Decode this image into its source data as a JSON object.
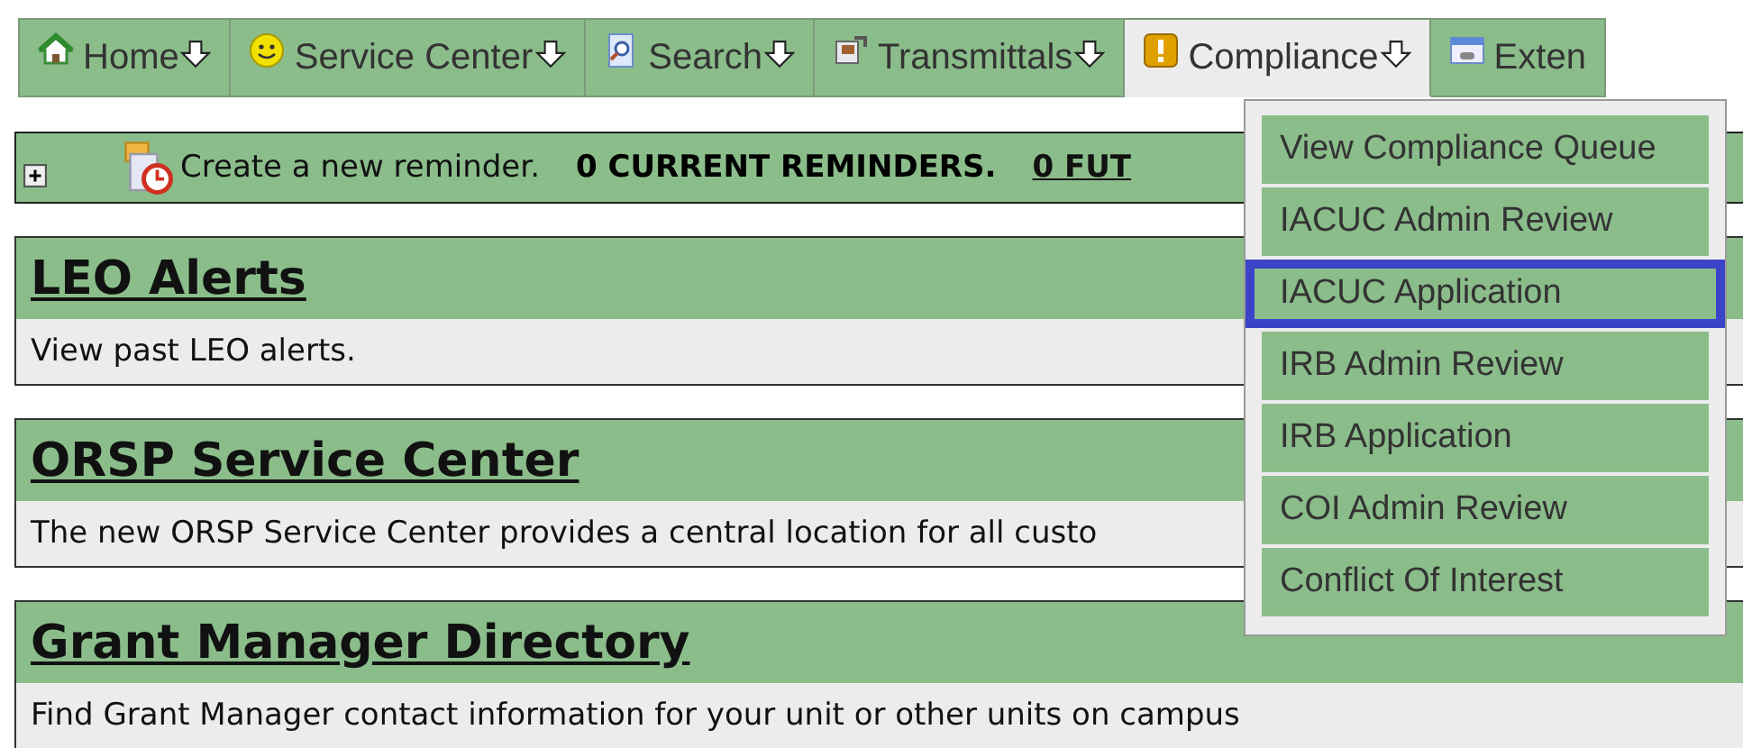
{
  "nav": {
    "tabs": [
      {
        "label": "Home",
        "kind": "home",
        "selected": false
      },
      {
        "label": "Service Center",
        "kind": "service",
        "selected": false
      },
      {
        "label": "Search",
        "kind": "search",
        "selected": false
      },
      {
        "label": "Transmittals",
        "kind": "transmittals",
        "selected": false
      },
      {
        "label": "Compliance",
        "kind": "compliance",
        "selected": true
      },
      {
        "label": "Exten",
        "kind": "extension",
        "selected": false
      }
    ]
  },
  "reminders": {
    "create": "Create a new reminder.",
    "current": "0 CURRENT REMINDERS.",
    "future": "0 FUT"
  },
  "cards": [
    {
      "title": "LEO Alerts",
      "description": "View past LEO alerts."
    },
    {
      "title": "ORSP Service Center",
      "description": "The new ORSP Service Center provides a central location for all custo"
    },
    {
      "title": "Grant Manager Directory",
      "description": "Find Grant Manager contact information for your unit or other units on campus"
    }
  ],
  "dropdown": {
    "items": [
      {
        "label": "View Compliance Queue",
        "selected": false
      },
      {
        "label": "IACUC Admin Review",
        "selected": false
      },
      {
        "label": "IACUC Application",
        "selected": true
      },
      {
        "label": "IRB Admin Review",
        "selected": false
      },
      {
        "label": "IRB Application",
        "selected": false
      },
      {
        "label": "COI Admin Review",
        "selected": false
      },
      {
        "label": "Conflict Of Interest",
        "selected": false
      }
    ]
  }
}
